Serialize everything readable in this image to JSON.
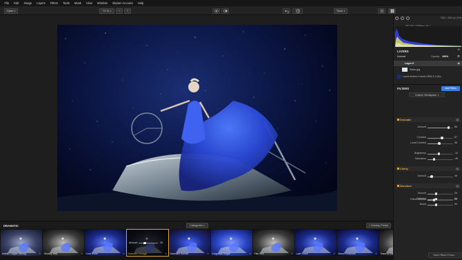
{
  "menu": [
    "File",
    "Edit",
    "Image",
    "Layers",
    "Filters",
    "Tools",
    "Mask",
    "View",
    "Window",
    "Skylum Account",
    "Help"
  ],
  "toolbar": {
    "open_label": "Open",
    "zoom_label": "72 %",
    "zoom_minus": "−",
    "zoom_plus": "+",
    "tools_label": "Tools"
  },
  "histogram": {
    "file_info": "7360 × 4912 px  |  8 bit",
    "exif": "ISO 250 | 1/200sec | f/7.1"
  },
  "layers": {
    "title": "LAYERS",
    "blend_mode": "Normal",
    "opacity_label": "Opacity:",
    "opacity_value": "100%",
    "items": [
      {
        "name": "Layer 0"
      },
      {
        "name": "Stars.jpg"
      },
      {
        "name": "Laura Anders Kutrub-2368-3-3 (Ed..."
      }
    ]
  },
  "filters": {
    "title": "FILTERS",
    "add_button": "Add Filters",
    "workspace": "Custom Workspace",
    "groups": [
      {
        "name": "Dramatic",
        "sliders": [
          {
            "label": "Amount",
            "value": "83",
            "pct": 0.83
          },
          {
            "label": "Contrast",
            "value": "57",
            "pct": 0.57
          },
          {
            "label": "Local Contrast",
            "value": "46",
            "pct": 0.46
          },
          {
            "label": "Brightness",
            "value": "-12",
            "pct": 0.44
          },
          {
            "label": "Saturation",
            "value": "-49",
            "pct": 0.255
          }
        ]
      },
      {
        "name": "Clarity",
        "sliders": [
          {
            "label": "Amount",
            "value": "16",
            "pct": 0.16
          }
        ]
      },
      {
        "name": "Structure",
        "sliders": [
          {
            "label": "Amount",
            "value": "34",
            "pct": 0.34
          },
          {
            "label": "Softness",
            "value": "34",
            "pct": 0.34
          },
          {
            "label": "Boost",
            "value": "34",
            "pct": 0.34
          }
        ]
      }
    ],
    "filters_amount": {
      "label": "Filters Amount",
      "value": "25",
      "pct": 0.25
    }
  },
  "save_preset": "Save Filters Preset...",
  "filmstrip": {
    "category_title": "DRAMATIC",
    "categories_label": "Categories",
    "overlay_preset_label": "+ Overlay Preset",
    "active_amount_label": "Amount",
    "active_amount_value": "25",
    "presets": [
      {
        "name": "Artistic Copper Strong",
        "tone": "cool"
      },
      {
        "name": "Ghostly Mist",
        "tone": "mono"
      },
      {
        "name": "Cold Moon",
        "tone": "blue"
      },
      {
        "name": "Dramatic Grunge",
        "tone": "dark"
      },
      {
        "name": "Dramatic Sunset",
        "tone": "warm"
      },
      {
        "name": "Enigmatic Bright",
        "tone": "bright"
      },
      {
        "name": "Film Noir",
        "tone": "mono"
      },
      {
        "name": "Last Scout",
        "tone": "blue"
      },
      {
        "name": "Mood Enhancer",
        "tone": "blue"
      },
      {
        "name": "Tears in Rain",
        "tone": "mono"
      }
    ]
  },
  "colors": {
    "accent": "#f0a63c",
    "blue_button": "#3a7ee0"
  }
}
